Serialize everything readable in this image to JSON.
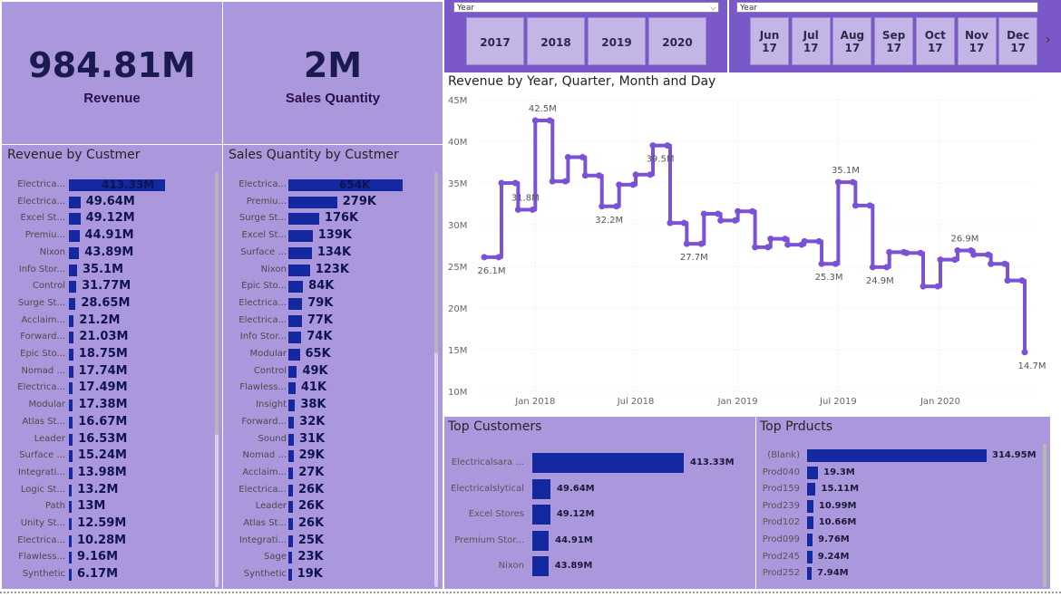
{
  "kpis": [
    {
      "value": "984.81M",
      "label": "Revenue"
    },
    {
      "value": "2M",
      "label": "Sales Quantity"
    }
  ],
  "revenue_by_customer": {
    "title": "Revenue by Custmer",
    "rows": [
      {
        "cat": "Electrica...",
        "label": "413.33M",
        "value": 413.33
      },
      {
        "cat": "Electrica...",
        "label": "49.64M",
        "value": 49.64
      },
      {
        "cat": "Excel St...",
        "label": "49.12M",
        "value": 49.12
      },
      {
        "cat": "Premiu...",
        "label": "44.91M",
        "value": 44.91
      },
      {
        "cat": "Nixon",
        "label": "43.89M",
        "value": 43.89
      },
      {
        "cat": "Info Stor...",
        "label": "35.1M",
        "value": 35.1
      },
      {
        "cat": "Control",
        "label": "31.77M",
        "value": 31.77
      },
      {
        "cat": "Surge St...",
        "label": "28.65M",
        "value": 28.65
      },
      {
        "cat": "Acclaim...",
        "label": "21.2M",
        "value": 21.2
      },
      {
        "cat": "Forward...",
        "label": "21.03M",
        "value": 21.03
      },
      {
        "cat": "Epic Sto...",
        "label": "18.75M",
        "value": 18.75
      },
      {
        "cat": "Nomad ...",
        "label": "17.74M",
        "value": 17.74
      },
      {
        "cat": "Electrica...",
        "label": "17.49M",
        "value": 17.49
      },
      {
        "cat": "Modular",
        "label": "17.38M",
        "value": 17.38
      },
      {
        "cat": "Atlas St...",
        "label": "16.67M",
        "value": 16.67
      },
      {
        "cat": "Leader",
        "label": "16.53M",
        "value": 16.53
      },
      {
        "cat": "Surface ...",
        "label": "15.24M",
        "value": 15.24
      },
      {
        "cat": "Integrati...",
        "label": "13.98M",
        "value": 13.98
      },
      {
        "cat": "Logic St...",
        "label": "13.2M",
        "value": 13.2
      },
      {
        "cat": "Path",
        "label": "13M",
        "value": 13
      },
      {
        "cat": "Unity St...",
        "label": "12.59M",
        "value": 12.59
      },
      {
        "cat": "Electrica...",
        "label": "10.28M",
        "value": 10.28
      },
      {
        "cat": "Flawless...",
        "label": "9.16M",
        "value": 9.16
      },
      {
        "cat": "Synthetic",
        "label": "6.17M",
        "value": 6.17
      }
    ]
  },
  "quantity_by_customer": {
    "title": "Sales Quantity by Custmer",
    "rows": [
      {
        "cat": "Electrica...",
        "label": "654K",
        "value": 654
      },
      {
        "cat": "Premiu...",
        "label": "279K",
        "value": 279
      },
      {
        "cat": "Surge St...",
        "label": "176K",
        "value": 176
      },
      {
        "cat": "Excel St...",
        "label": "139K",
        "value": 139
      },
      {
        "cat": "Surface ...",
        "label": "134K",
        "value": 134
      },
      {
        "cat": "Nixon",
        "label": "123K",
        "value": 123
      },
      {
        "cat": "Epic Sto...",
        "label": "84K",
        "value": 84
      },
      {
        "cat": "Electrica...",
        "label": "79K",
        "value": 79
      },
      {
        "cat": "Electrica...",
        "label": "77K",
        "value": 77
      },
      {
        "cat": "Info Stor...",
        "label": "74K",
        "value": 74
      },
      {
        "cat": "Modular",
        "label": "65K",
        "value": 65
      },
      {
        "cat": "Control",
        "label": "49K",
        "value": 49
      },
      {
        "cat": "Flawless...",
        "label": "41K",
        "value": 41
      },
      {
        "cat": "Insight",
        "label": "38K",
        "value": 38
      },
      {
        "cat": "Forward...",
        "label": "32K",
        "value": 32
      },
      {
        "cat": "Sound",
        "label": "31K",
        "value": 31
      },
      {
        "cat": "Nomad ...",
        "label": "29K",
        "value": 29
      },
      {
        "cat": "Acclaim...",
        "label": "27K",
        "value": 27
      },
      {
        "cat": "Electrica...",
        "label": "26K",
        "value": 26
      },
      {
        "cat": "Leader",
        "label": "26K",
        "value": 26
      },
      {
        "cat": "Atlas St...",
        "label": "26K",
        "value": 26
      },
      {
        "cat": "Integrati...",
        "label": "25K",
        "value": 25
      },
      {
        "cat": "Sage",
        "label": "23K",
        "value": 23
      },
      {
        "cat": "Synthetic",
        "label": "19K",
        "value": 19
      }
    ]
  },
  "year_slicer": {
    "header": "Year",
    "tiles": [
      "2017",
      "2018",
      "2019",
      "2020"
    ]
  },
  "month_slicer": {
    "header": "Year",
    "tiles": [
      {
        "month": "Jun",
        "year": "17"
      },
      {
        "month": "Jul",
        "year": "17"
      },
      {
        "month": "Aug",
        "year": "17"
      },
      {
        "month": "Sep",
        "year": "17"
      },
      {
        "month": "Oct",
        "year": "17"
      },
      {
        "month": "Nov",
        "year": "17"
      },
      {
        "month": "Dec",
        "year": "17"
      }
    ],
    "next_icon": "chevron-right-icon"
  },
  "line_chart": {
    "title": "Revenue by Year, Quarter, Month and Day",
    "y_ticks": [
      "45M",
      "40M",
      "35M",
      "30M",
      "25M",
      "20M",
      "15M",
      "10M"
    ],
    "x_ticks": [
      "Jan 2018",
      "Jul 2018",
      "Jan 2019",
      "Jul 2019",
      "Jan 2020"
    ]
  },
  "chart_data": [
    {
      "type": "line",
      "title": "Revenue by Year, Quarter, Month and Day",
      "x": [
        "2017-10",
        "2017-11",
        "2017-12",
        "2018-01",
        "2018-02",
        "2018-03",
        "2018-04",
        "2018-05",
        "2018-06",
        "2018-07",
        "2018-08",
        "2018-09",
        "2018-10",
        "2018-11",
        "2018-12",
        "2019-01",
        "2019-02",
        "2019-03",
        "2019-04",
        "2019-05",
        "2019-06",
        "2019-07",
        "2019-08",
        "2019-09",
        "2019-10",
        "2019-11",
        "2019-12",
        "2020-01",
        "2020-02",
        "2020-03",
        "2020-04",
        "2020-05",
        "2020-06"
      ],
      "series": [
        {
          "values": [
            26.1,
            35.0,
            31.8,
            42.5,
            35.2,
            38.1,
            35.9,
            32.2,
            34.8,
            36.0,
            39.5,
            30.2,
            27.7,
            31.3,
            30.5,
            31.6,
            27.3,
            28.3,
            27.6,
            28.0,
            25.3,
            35.1,
            32.3,
            24.9,
            26.7,
            26.6,
            22.6,
            25.8,
            26.9,
            26.4,
            25.3,
            23.3,
            14.7
          ]
        }
      ],
      "data_labels": [
        {
          "x": "2017-10",
          "label": "26.1M"
        },
        {
          "x": "2017-12",
          "label": "31.8M"
        },
        {
          "x": "2018-01",
          "label": "42.5M"
        },
        {
          "x": "2018-05",
          "label": "32.2M"
        },
        {
          "x": "2018-08",
          "label": "39.5M"
        },
        {
          "x": "2018-10",
          "label": "27.7M"
        },
        {
          "x": "2019-06",
          "label": "25.3M"
        },
        {
          "x": "2019-07",
          "label": "35.1M"
        },
        {
          "x": "2019-09",
          "label": "24.9M"
        },
        {
          "x": "2020-02",
          "label": "26.9M"
        },
        {
          "x": "2020-06",
          "label": "14.7M"
        }
      ],
      "ylim": [
        10,
        45
      ],
      "grid": true,
      "color": "#7b52d6"
    },
    {
      "type": "bar",
      "title": "Top Customers",
      "categories": [
        "Electricalsara ...",
        "Electricalslytical",
        "Excel Stores",
        "Premium Stor...",
        "Nixon"
      ],
      "values": [
        413.33,
        49.64,
        49.12,
        44.91,
        43.89
      ],
      "labels": [
        "413.33M",
        "49.64M",
        "49.12M",
        "44.91M",
        "43.89M"
      ]
    },
    {
      "type": "bar",
      "title": "Top Prducts",
      "categories": [
        "(Blank)",
        "Prod040",
        "Prod159",
        "Prod239",
        "Prod102",
        "Prod099",
        "Prod245",
        "Prod252"
      ],
      "values": [
        314.95,
        19.3,
        15.11,
        10.99,
        10.66,
        9.76,
        9.24,
        7.94
      ],
      "labels": [
        "314.95M",
        "19.3M",
        "15.11M",
        "10.99M",
        "10.66M",
        "9.76M",
        "9.24M",
        "7.94M"
      ]
    }
  ],
  "colors": {
    "panel": "#ab97dc",
    "bar": "#1428a0",
    "line": "#7b52d6",
    "slicer_bg": "#7b58c8"
  }
}
